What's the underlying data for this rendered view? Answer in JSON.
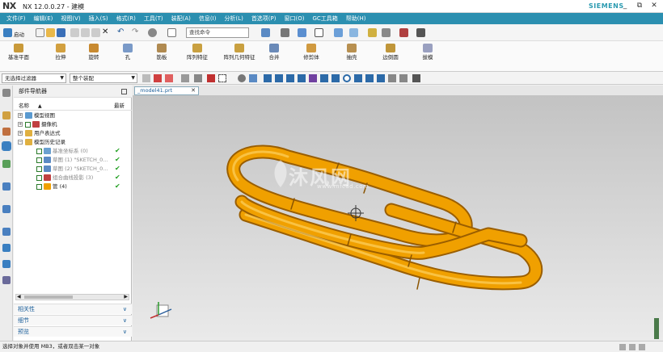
{
  "app": {
    "logo": "NX",
    "title": "NX 12.0.0.27 - 建模",
    "brand": "SIEMENS"
  },
  "window_buttons": [
    "_",
    "⧉",
    "✕"
  ],
  "menu": [
    "文件(F)",
    "编辑(E)",
    "视图(V)",
    "插入(S)",
    "格式(R)",
    "工具(T)",
    "装配(A)",
    "信息(I)",
    "分析(L)",
    "首选项(P)",
    "窗口(O)",
    "GC工具箱",
    "帮助(H)"
  ],
  "toolbar": {
    "start_label": "启动",
    "search_placeholder": "查找命令"
  },
  "ribbon": [
    "基准平面",
    "拉伸",
    "旋转",
    "孔",
    "筋板",
    "阵列特征",
    "阵列几何特征",
    "合并",
    "修剪体",
    "抽壳",
    "边倒圆",
    "拔模"
  ],
  "selection": {
    "filter": "无选择过滤器",
    "scope": "整个装配"
  },
  "nav": {
    "title": "部件导航器",
    "col_name": "名称",
    "col_latest": "最新",
    "items": [
      {
        "label": "模型视图",
        "indent": 0,
        "exp": "+",
        "check": false,
        "latest": false,
        "gray": false
      },
      {
        "label": "摄像机",
        "indent": 0,
        "exp": "+",
        "check": true,
        "latest": false,
        "gray": false
      },
      {
        "label": "用户表达式",
        "indent": 0,
        "exp": "+",
        "check": false,
        "latest": false,
        "gray": false
      },
      {
        "label": "模型历史记录",
        "indent": 0,
        "exp": "−",
        "check": false,
        "latest": false,
        "gray": false
      },
      {
        "label": "基准坐标系 (0)",
        "indent": 1,
        "exp": "",
        "check": true,
        "latest": true,
        "gray": true
      },
      {
        "label": "草图 (1) \"SKETCH_0...",
        "indent": 1,
        "exp": "",
        "check": true,
        "latest": true,
        "gray": true
      },
      {
        "label": "草图 (2) \"SKETCH_0...",
        "indent": 1,
        "exp": "",
        "check": true,
        "latest": true,
        "gray": true
      },
      {
        "label": "组合曲线投影 (3)",
        "indent": 1,
        "exp": "",
        "check": true,
        "latest": true,
        "gray": true
      },
      {
        "label": "管 (4)",
        "indent": 1,
        "exp": "",
        "check": true,
        "latest": true,
        "gray": false
      }
    ],
    "accordion": [
      "相关性",
      "细节",
      "预览"
    ]
  },
  "tab": {
    "label": "_model41.prt"
  },
  "watermark": {
    "main": "沐风网",
    "sub": "www.mfcad.com"
  },
  "status": "选择对象并使用 MB3，或者双击某一对象",
  "colors": {
    "menubar": "#2b8fb0",
    "pipe": "#f0a000",
    "pipe_shade": "#c97800",
    "check": "#22a022"
  }
}
